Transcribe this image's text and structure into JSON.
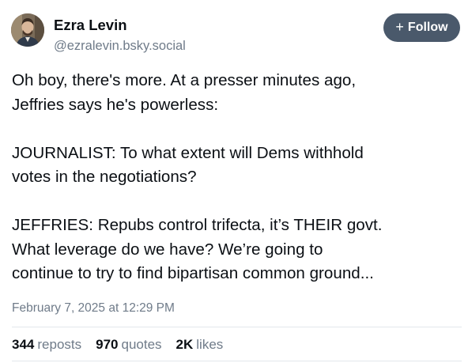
{
  "author": {
    "display_name": "Ezra Levin",
    "handle": "@ezralevin.bsky.social",
    "avatar_icon": "user-avatar-photo"
  },
  "follow_button": {
    "icon": "plus-icon",
    "icon_glyph": "+",
    "label": "Follow",
    "color": "#4a596b"
  },
  "post": {
    "text": "Oh boy, there's more. At a presser minutes ago,\nJeffries says he's powerless:\n\nJOURNALIST: To what extent will Dems withhold\nvotes in the negotiations?\n\nJEFFRIES: Repubs control trifecta, it’s THEIR govt.\nWhat leverage do we have? We’re going to\ncontinue to try to find bipartisan common ground...",
    "timestamp": "February 7, 2025 at 12:29 PM"
  },
  "stats": {
    "reposts": {
      "count": "344",
      "label": "reposts"
    },
    "quotes": {
      "count": "970",
      "label": "quotes"
    },
    "likes": {
      "count": "2K",
      "label": "likes"
    }
  }
}
